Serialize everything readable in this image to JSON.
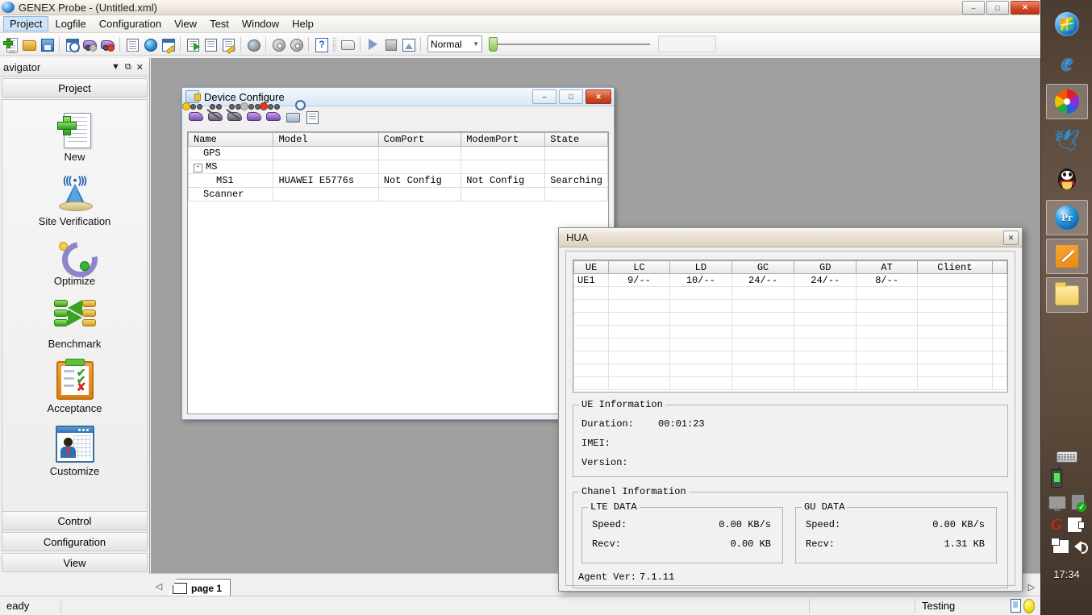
{
  "app": {
    "title": "GENEX Probe - (Untitled.xml)",
    "window_buttons": {
      "minimize": "–",
      "maximize": "□",
      "close": "✕"
    },
    "menu": [
      {
        "label": "Project",
        "active": true
      },
      {
        "label": "Logfile",
        "active": false
      },
      {
        "label": "Configuration",
        "active": false
      },
      {
        "label": "View",
        "active": false
      },
      {
        "label": "Test",
        "active": false
      },
      {
        "label": "Window",
        "active": false
      },
      {
        "label": "Help",
        "active": false
      }
    ],
    "toolbar": {
      "icons": [
        "new-document-icon",
        "open-folder-icon",
        "save-disk-icon",
        "report-icon",
        "device-disconnect-icon",
        "device-connect-icon",
        "list-icon",
        "globe-icon",
        "table-new-icon",
        "run-report-icon",
        "grid-report-icon",
        "edit-report-icon",
        "dark-globe-icon",
        "playback-icon",
        "record-icon",
        "help-icon",
        "open-log-icon",
        "play-icon",
        "stop-icon",
        "export-image-icon"
      ],
      "mode_select": {
        "value": "Normal",
        "arrow": "▼"
      },
      "slider_value": 0
    }
  },
  "navigator": {
    "title": "avigator",
    "controls": {
      "dropdown": "▼",
      "pin": "⧉",
      "close": "✕"
    },
    "header_button": "Project",
    "items": [
      {
        "label": "New",
        "icon": "new-project-icon"
      },
      {
        "label": "Site Verification",
        "icon": "cell-tower-icon"
      },
      {
        "label": "Optimize",
        "icon": "optimize-refresh-icon"
      },
      {
        "label": "Benchmark",
        "icon": "benchmark-arrows-icon"
      },
      {
        "label": "Acceptance",
        "icon": "clipboard-check-icon"
      },
      {
        "label": "Customize",
        "icon": "customize-user-icon"
      }
    ],
    "bottom_sections": [
      "Control",
      "Configuration",
      "View"
    ]
  },
  "device_configure": {
    "title": "Device Configure",
    "window_buttons": {
      "minimize": "–",
      "maximize": "□",
      "close": "✕"
    },
    "toolbar_icons": [
      "add-device-icon",
      "delete-device-icon",
      "disable-device-icon",
      "disconnect-device-icon",
      "connect-device-icon",
      "print-icon",
      "device-info-icon"
    ],
    "columns": [
      "Name",
      "Model",
      "ComPort",
      "ModemPort",
      "State"
    ],
    "rows": [
      {
        "name": "GPS",
        "model": "",
        "comport": "",
        "modemport": "",
        "state": "",
        "indent": 1,
        "expander": ""
      },
      {
        "name": "MS",
        "model": "",
        "comport": "",
        "modemport": "",
        "state": "",
        "indent": 1,
        "expander": "-"
      },
      {
        "name": "MS1",
        "model": "HUAWEI E5776s",
        "comport": "Not Config",
        "modemport": "Not Config",
        "state": "Searching",
        "indent": 2,
        "expander": ""
      },
      {
        "name": "Scanner",
        "model": "",
        "comport": "",
        "modemport": "",
        "state": "",
        "indent": 1,
        "expander": ""
      }
    ]
  },
  "hua_dialog": {
    "title": "HUA",
    "close_button": "✕",
    "columns": [
      "UE",
      "LC",
      "LD",
      "GC",
      "GD",
      "AT",
      "Client"
    ],
    "rows": [
      {
        "ue": "UE1",
        "lc": "9/--",
        "ld": "10/--",
        "gc": "24/--",
        "gd": "24/--",
        "at": "8/--",
        "client": ""
      }
    ],
    "ue_information": {
      "legend": "UE Information",
      "duration_label": "Duration:",
      "duration_value": "00:01:23",
      "imei_label": "IMEI:",
      "imei_value": "",
      "version_label": "Version:",
      "version_value": ""
    },
    "chanel_information": {
      "legend": "Chanel Information",
      "lte": {
        "legend": "LTE DATA",
        "speed_label": "Speed:",
        "speed_value": "0.00 KB/s",
        "recv_label": "Recv:",
        "recv_value": "0.00 KB"
      },
      "gu": {
        "legend": "GU DATA",
        "speed_label": "Speed:",
        "speed_value": "0.00 KB/s",
        "recv_label": "Recv:",
        "recv_value": "1.31 KB"
      }
    },
    "agent_ver_label": "Agent Ver:",
    "agent_ver_value": "7.1.11"
  },
  "tabstrip": {
    "scroll_left": "◁",
    "scroll_right": "▷",
    "tabs": [
      {
        "label": "page 1",
        "icon": "envelope-icon",
        "active": true
      }
    ]
  },
  "statusbar": {
    "ready_text": "eady",
    "testing_text": "Testing",
    "device_icon": "device-icon",
    "indicator_icon": "yellow-status-light"
  },
  "dock": {
    "icons": [
      {
        "name": "windows-start-icon",
        "boxed": false
      },
      {
        "name": "internet-explorer-icon",
        "boxed": false
      },
      {
        "name": "pinwheel-browser-icon",
        "boxed": true
      },
      {
        "name": "blue-bird-icon",
        "boxed": false
      },
      {
        "name": "qq-penguin-icon",
        "boxed": false
      },
      {
        "name": "premiere-pro-icon",
        "boxed": true
      },
      {
        "name": "orange-editor-icon",
        "boxed": true
      },
      {
        "name": "folder-explorer-icon",
        "boxed": true
      }
    ],
    "tray_icons": [
      "keyboard-icon",
      "phone-icon",
      "monitor-icon",
      "usb-safe-remove-icon",
      "g-red-icon",
      "plug-icon",
      "network-icon",
      "volume-icon"
    ],
    "clock": "17:34"
  },
  "colors": {
    "accent": "#2f6fb0",
    "title_gradient_top": "#faf7f2",
    "close_button": "#cf4520",
    "desktop": "#9a9a9a",
    "dock_bg": "#5d4b3c",
    "status_yellow": "#f2e222"
  }
}
